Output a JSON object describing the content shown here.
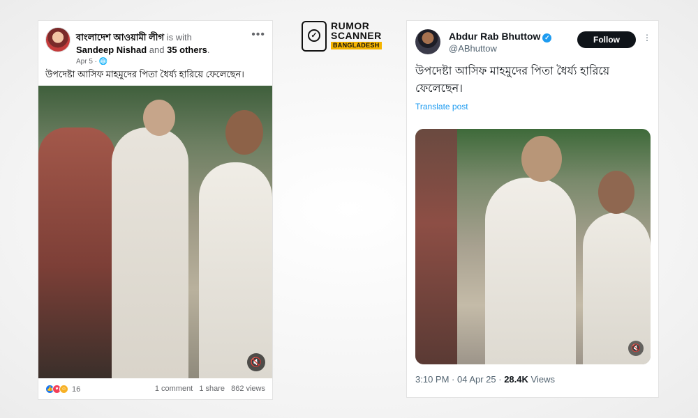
{
  "facebook_post": {
    "page_name": "বাংলাদেশ আওয়ামী লীগ",
    "is_with": "is with",
    "tagged_person": "Sandeep Nishad",
    "and": "and",
    "others": "35 others",
    "period": ".",
    "date": "Apr 5 ·",
    "globe_icon": "🌐",
    "more_icon": "•••",
    "text": "উপদেষ্টা আসিফ মাহমুদের পিতা ধৈর্য্য হারিয়ে ফেলেছেন।",
    "mute_icon": "🔇",
    "reaction_count": "16",
    "comments": "1 comment",
    "shares": "1 share",
    "views": "862 views"
  },
  "logo": {
    "line1": "RUMOR",
    "line2": "SCANNER",
    "line3": "BANGLADESH",
    "icon_mark": "✓"
  },
  "x_post": {
    "display_name": "Abdur Rab Bhuttow",
    "verified_icon": "✓",
    "handle": "@ABhuttow",
    "follow_label": "Follow",
    "more_icon": "⋮",
    "text": "উপদেষ্টা আসিফ মাহমুদের পিতা ধৈর্য্য হারিয়ে ফেলেছেন।",
    "translate_label": "Translate post",
    "mute_icon": "🔇",
    "time": "3:10 PM · 04 Apr 25 ·",
    "view_count": "28.4K",
    "views_label": "Views"
  },
  "colors": {
    "twitter_blue": "#1d9bf0",
    "facebook_blue": "#1877f2",
    "logo_accent": "#f5b400"
  }
}
